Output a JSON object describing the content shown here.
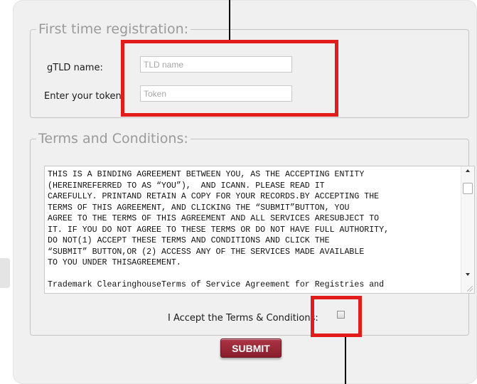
{
  "registration": {
    "legend": "First time registration:",
    "gtld_label": "gTLD name:",
    "gtld_placeholder": "TLD name",
    "token_label": "Enter your token:",
    "token_placeholder": "Token"
  },
  "terms": {
    "legend": "Terms and Conditions:",
    "text": "THIS IS A BINDING AGREEMENT BETWEEN YOU, AS THE ACCEPTING ENTITY\n(HEREINREFERRED TO AS “YOU”),  AND ICANN. PLEASE READ IT\nCAREFULLY. PRINTAND RETAIN A COPY FOR YOUR RECORDS.BY ACCEPTING THE\nTERMS OF THIS AGREEMENT, AND CLICKING THE “SUBMIT”BUTTON, YOU\nAGREE TO THE TERMS OF THIS AGREEMENT AND ALL SERVICES ARESUBJECT TO\nIT. IF YOU DO NOT AGREE TO THESE TERMS OR DO NOT HAVE FULL AUTHORITY,\nDO NOT(1) ACCEPT THESE TERMS AND CONDITIONS AND CLICK THE\n“SUBMIT” BUTTON,OR (2) ACCESS ANY OF THE SERVICES MADE AVAILABLE\nTO YOU UNDER THISAGREEMENT.\n\nTrademark ClearinghouseTerms of Service Agreement for Registries and",
    "accept_label": "I Accept the Terms & Conditions:"
  },
  "submit_label": "SUBMIT",
  "colors": {
    "highlight": "#e21b1b",
    "submit": "#9a2536",
    "panel": "#f0f0f0"
  }
}
